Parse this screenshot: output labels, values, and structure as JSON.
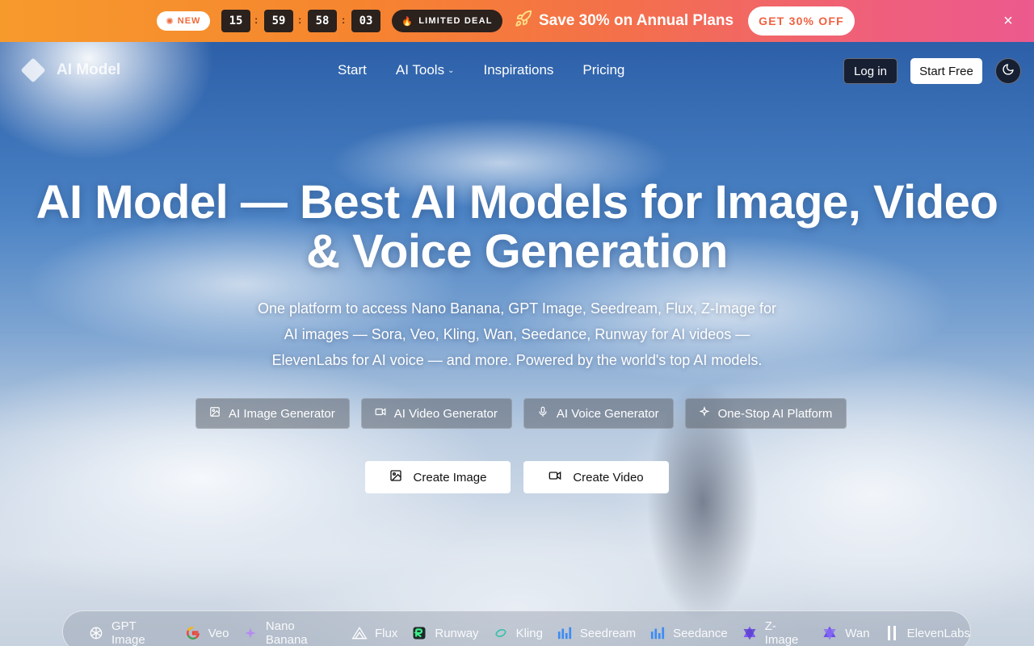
{
  "promo": {
    "new_label": "NEW",
    "countdown": [
      "15",
      "59",
      "58",
      "03"
    ],
    "deal_label": "LIMITED DEAL",
    "message": "Save 30% on Annual Plans",
    "cta_label": "GET 30% OFF",
    "close_glyph": "×"
  },
  "nav": {
    "logo_text": "AI Model",
    "links": [
      "Start",
      "AI Tools",
      "Inspirations",
      "Pricing"
    ],
    "login_label": "Log in",
    "start_label": "Start Free"
  },
  "hero": {
    "headline_line1": "AI Model — Best AI Models for Image, Video",
    "headline_line2": "& Voice Generation",
    "subtitle_line1": "One platform to access Nano Banana, GPT Image, Seedream, Flux, Z-Image for",
    "subtitle_line2": "AI images — Sora, Veo, Kling, Wan, Seedance, Runway for AI videos —",
    "subtitle_line3": "ElevenLabs for AI voice — and more. Powered by the world's top AI models.",
    "chips": [
      {
        "label": "AI Image Generator",
        "icon": "image-icon"
      },
      {
        "label": "AI Video Generator",
        "icon": "video-icon"
      },
      {
        "label": "AI Voice Generator",
        "icon": "mic-icon"
      },
      {
        "label": "One-Stop AI Platform",
        "icon": "sparkle-icon"
      }
    ],
    "cta_image": "Create Image",
    "cta_video": "Create Video"
  },
  "models": [
    "GPT Image",
    "Veo",
    "Nano Banana",
    "Flux",
    "Runway",
    "Kling",
    "Seedream",
    "Seedance",
    "Z-Image",
    "Wan",
    "ElevenLabs"
  ],
  "colors": {
    "promo_start": "#f79a2c",
    "promo_end": "#ec5a8e",
    "dark": "#172033",
    "accent_orange": "#f06a3a"
  }
}
